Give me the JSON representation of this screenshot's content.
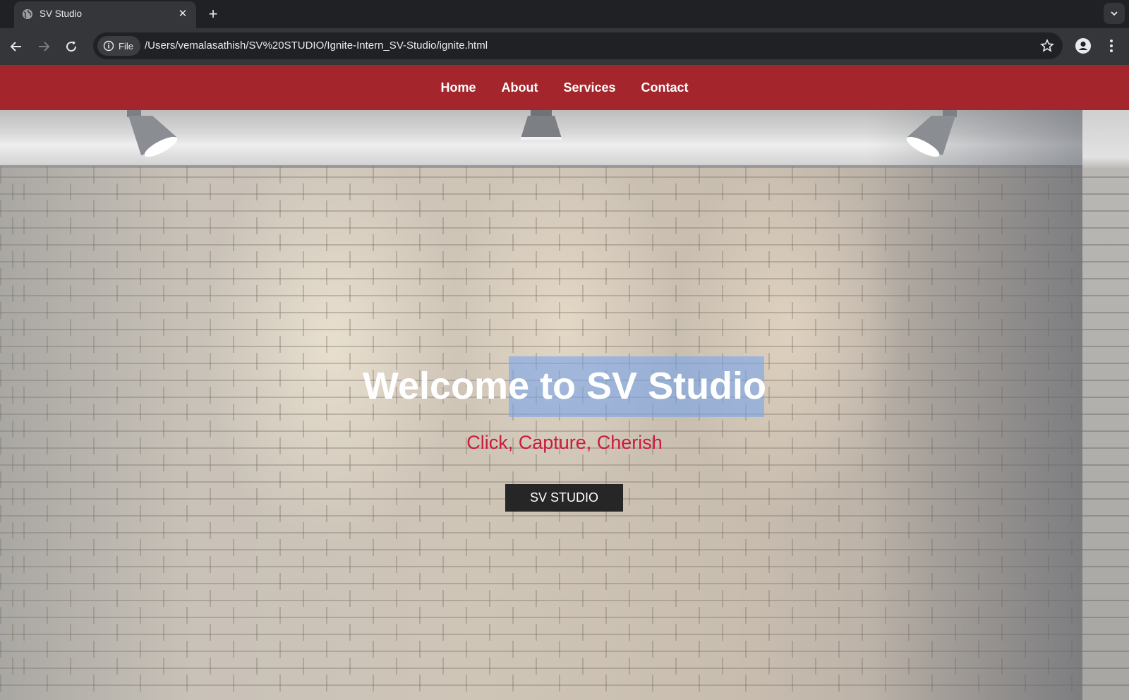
{
  "browser": {
    "tab_title": "SV Studio",
    "site_chip_label": "File",
    "url": "/Users/vemalasathish/SV%20STUDIO/Ignite-Intern_SV-Studio/ignite.html"
  },
  "site": {
    "nav": [
      "Home",
      "About",
      "Services",
      "Contact"
    ],
    "nav_color": "#a4262c",
    "hero": {
      "title": "Welcome to SV Studio",
      "tagline": "Click, Capture, Cherish",
      "button": "SV STUDIO",
      "tagline_color": "#cc1b3b"
    }
  }
}
